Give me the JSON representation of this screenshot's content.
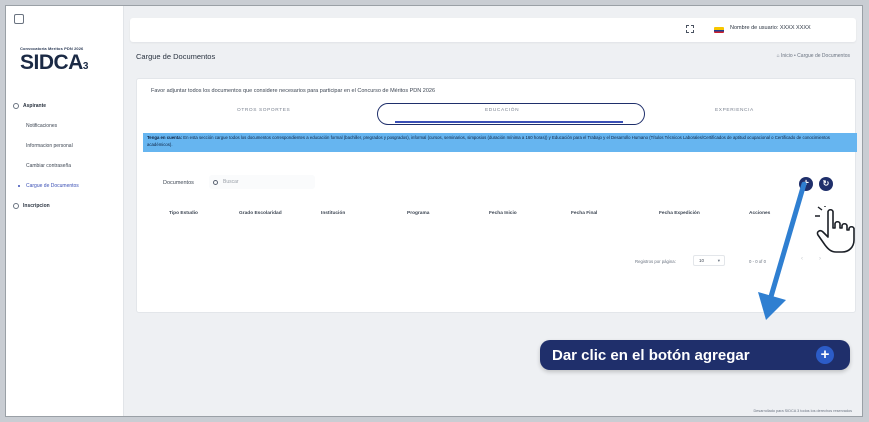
{
  "sidebar": {
    "logo_caption": "Convocatoria Meritos PDN 2026",
    "logo_text": "SIDCA",
    "logo_version": "3",
    "items": [
      {
        "label": "Aspirante",
        "level": "top"
      },
      {
        "label": "Notificaciones",
        "level": "sub"
      },
      {
        "label": "Informacion personal",
        "level": "sub"
      },
      {
        "label": "Cambiar contraseña",
        "level": "sub"
      },
      {
        "label": "Cargue de Documentos",
        "level": "sub",
        "active": true
      },
      {
        "label": "Inscripcion",
        "level": "top"
      }
    ]
  },
  "header": {
    "user_label": "Nombre de usuario: XXXX XXXX"
  },
  "page": {
    "title": "Cargue de Documentos",
    "breadcrumb": "Inicio • Cargue de Documentos"
  },
  "main": {
    "intro": "Favor adjuntar todos los documentos que considere necesarios para participar en el Concurso de Méritos PDN 2026",
    "tabs": [
      {
        "label": "OTROS SOPORTES"
      },
      {
        "label": "EDUCACIÓN",
        "active": true
      },
      {
        "label": "EXPERIENCIA"
      }
    ],
    "notice_title": "Tenga en cuenta:",
    "notice_body": "En esta sección cargue todos los documentos correspondientes a educación formal (bachiller, pregrados y posgrados), informal (cursos, seminarios, simposios (duración mínima a 160 horas)) y Educación para el Trabajo y el Desarrollo Humano (Títulos Técnicos Laborales/Certificados de aptitud ocupacional o Certificado de conocimientos académicos).",
    "documents_label": "Documentos",
    "search_placeholder": "Buscar",
    "add_button": "+",
    "refresh_button": "↻",
    "columns": [
      "Tipo Estudio",
      "Grado Escolaridad",
      "Institución",
      "Programa",
      "Fecha Inicio",
      "Fecha Final",
      "Fecha Expedición",
      "Acciones"
    ],
    "pager": {
      "rows_label": "Registros por página:",
      "rows_value": "10",
      "range": "0 - 0 of 0",
      "prev": "‹",
      "next": "›"
    }
  },
  "callout": {
    "text": "Dar clic en el botón agregar",
    "plus": "+"
  },
  "footer": {
    "text": "Desarrollado para SIDCA 3 todos los derechos reservados"
  },
  "colors": {
    "primary": "#1f2f6b",
    "notice_bg": "#66b5f0",
    "arrow": "#2f7fd1"
  }
}
